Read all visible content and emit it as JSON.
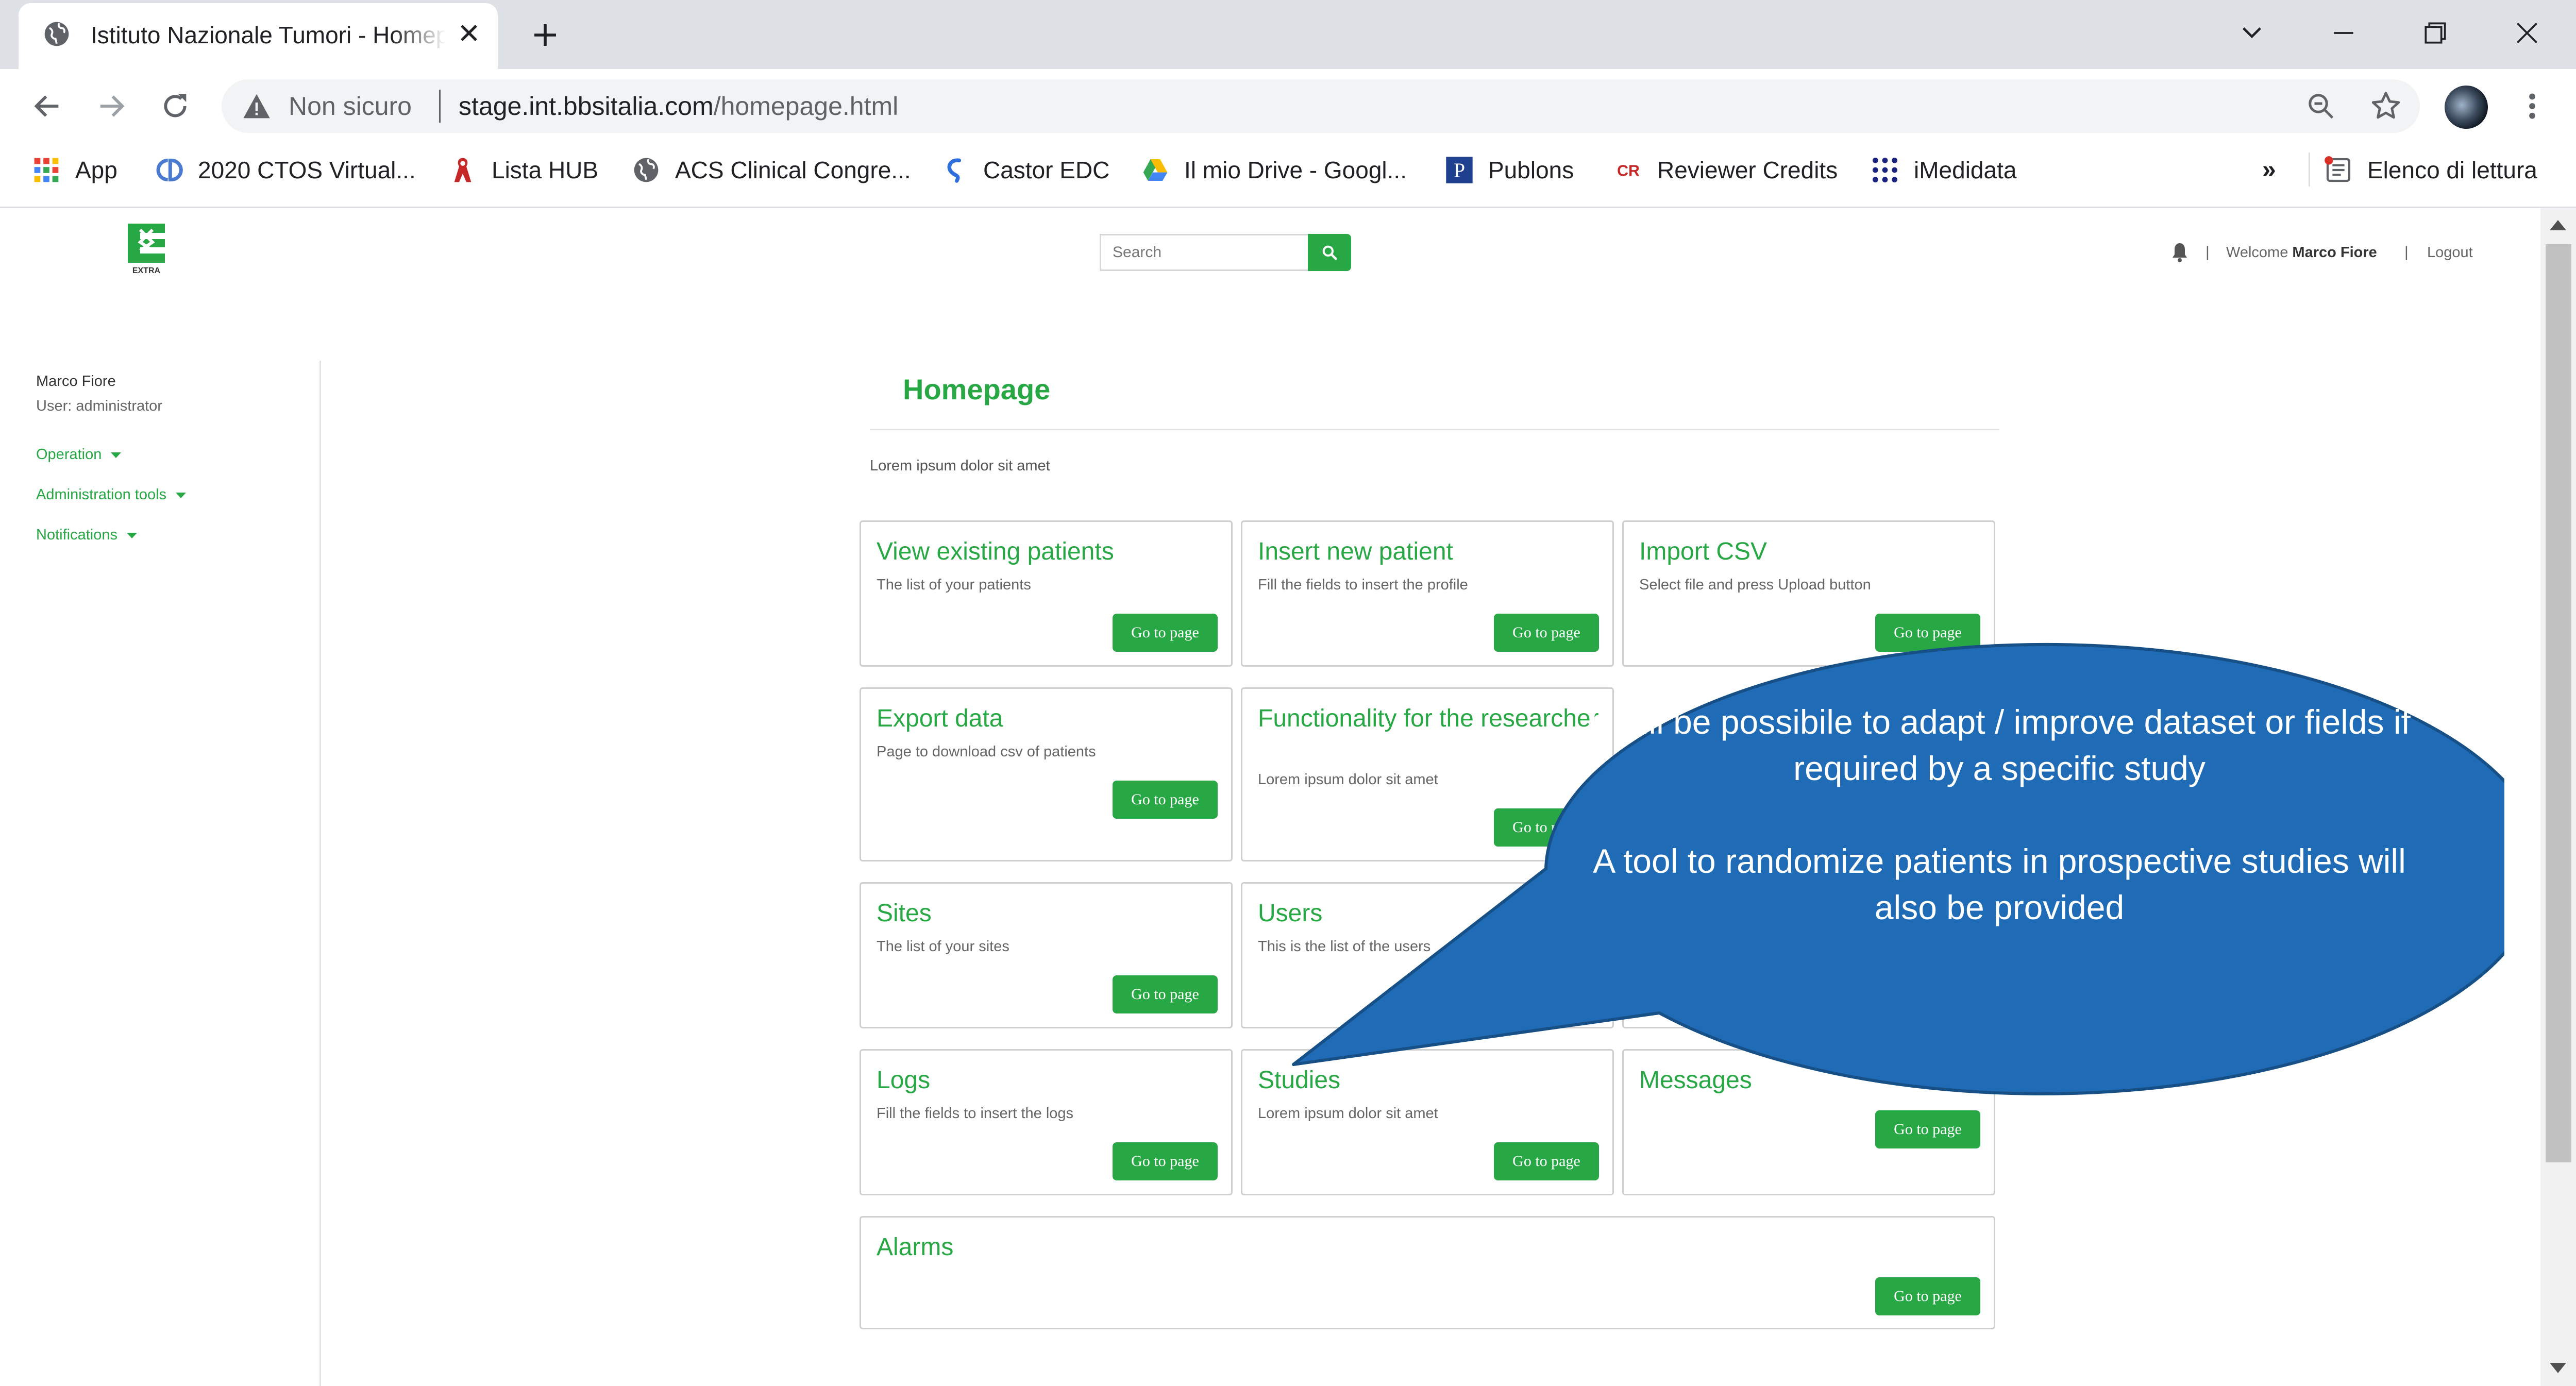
{
  "browser": {
    "tab_title": "Istituto Nazionale Tumori - Homepage",
    "not_secure_label": "Non sicuro",
    "url_host": "stage.int.bbsitalia.com",
    "url_path": "/homepage.html",
    "bookmarks": [
      {
        "label": "App",
        "icon": "apps-grid-icon"
      },
      {
        "label": "2020 CTOS Virtual...",
        "icon": "ctos-logo-icon"
      },
      {
        "label": "Lista HUB",
        "icon": "ribbon-icon"
      },
      {
        "label": "ACS Clinical Congre...",
        "icon": "globe-icon"
      },
      {
        "label": "Castor EDC",
        "icon": "castor-logo-icon"
      },
      {
        "label": "Il mio Drive - Googl...",
        "icon": "google-drive-icon"
      },
      {
        "label": "Publons",
        "icon": "publons-icon"
      },
      {
        "label": "Reviewer Credits",
        "icon": "reviewer-credits-icon"
      },
      {
        "label": "iMedidata",
        "icon": "imedidata-icon"
      }
    ],
    "more_bookmarks_label": "»",
    "reading_list_label": "Elenco di lettura"
  },
  "header": {
    "logo_text": "EXTRA",
    "search_placeholder": "Search",
    "separator": "|",
    "welcome_prefix": "Welcome",
    "welcome_user": "Marco Fiore",
    "logout_label": "Logout"
  },
  "sidebar": {
    "user_name": "Marco Fiore",
    "user_role": "User: administrator",
    "menu": [
      {
        "label": "Operation"
      },
      {
        "label": "Administration tools"
      },
      {
        "label": "Notifications"
      }
    ]
  },
  "main": {
    "title": "Homepage",
    "intro": "Lorem ipsum dolor sit amet",
    "button_label": "Go to page",
    "cards": [
      {
        "title": "View existing patients",
        "description": "The list of your patients"
      },
      {
        "title": "Insert new patient",
        "description": "Fill the fields to insert the profile"
      },
      {
        "title": "Import CSV",
        "description": "Select file and press Upload button"
      },
      {
        "title": "Export data",
        "description": "Page to download csv of patients"
      },
      {
        "title": "Functionality for the researcher",
        "description": "Lorem ipsum dolor sit amet"
      },
      {
        "title": "Sites",
        "description": "The list of your sites"
      },
      {
        "title": "Users",
        "description": "This is the list of the users"
      },
      {
        "title": "Logs",
        "description": "Fill the fields to insert the logs"
      },
      {
        "title": "Studies",
        "description": "Lorem ipsum dolor sit amet"
      },
      {
        "title": "Messages",
        "description": ""
      },
      {
        "title": "Alarms",
        "description": ""
      }
    ]
  },
  "callout": {
    "line1": "It will be possibile to adapt / improve dataset or fields if required by a specific study",
    "line2": "A tool to randomize patients in prospective studies will also be provided"
  },
  "colors": {
    "accent_green": "#28a745",
    "callout_blue": "#1f6bb6"
  }
}
